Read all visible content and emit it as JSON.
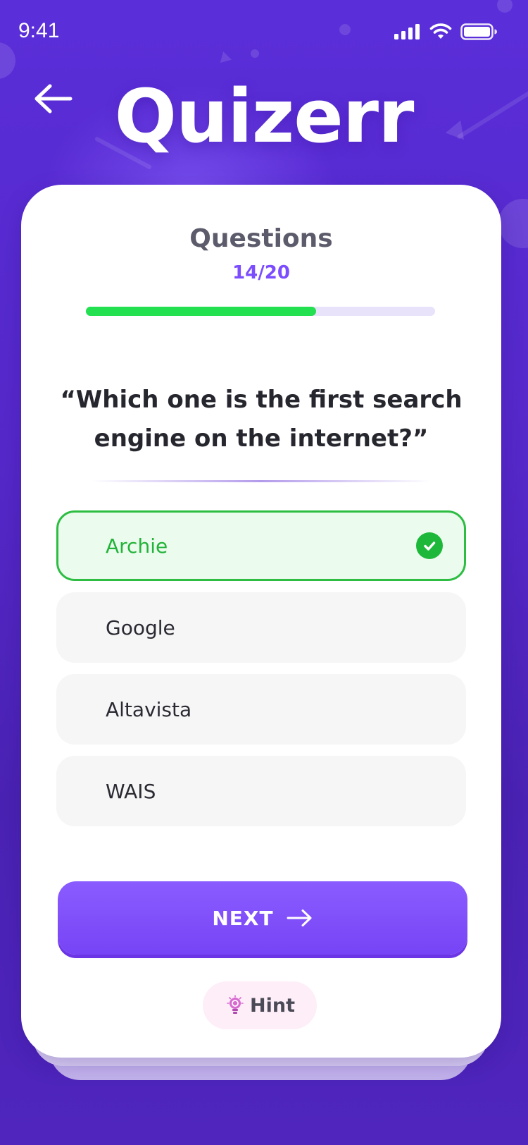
{
  "status_bar": {
    "time": "9:41",
    "icons": [
      "cellular-signal-icon",
      "wifi-icon",
      "battery-icon"
    ]
  },
  "header": {
    "back_icon": "arrow-left-icon",
    "title": "Quizerr"
  },
  "quiz": {
    "heading": "Questions",
    "counter": "14/20",
    "progress": 0.66,
    "question": "“Which one is the first search engine on the internet?”",
    "options": [
      {
        "label": "Archie",
        "state": "correct",
        "icon": "check-circle-icon"
      },
      {
        "label": "Google",
        "state": "default"
      },
      {
        "label": "Altavista",
        "state": "default"
      },
      {
        "label": "WAIS",
        "state": "default"
      }
    ],
    "next_label": "NEXT",
    "next_icon": "arrow-right-icon",
    "hint_label": "Hint",
    "hint_icon": "lightbulb-icon"
  },
  "colors": {
    "background": "#5528c9",
    "accent": "#7b4dff",
    "progress": "#22e04f",
    "correct": "#23b33a",
    "hint_bg": "#fdeef8"
  }
}
